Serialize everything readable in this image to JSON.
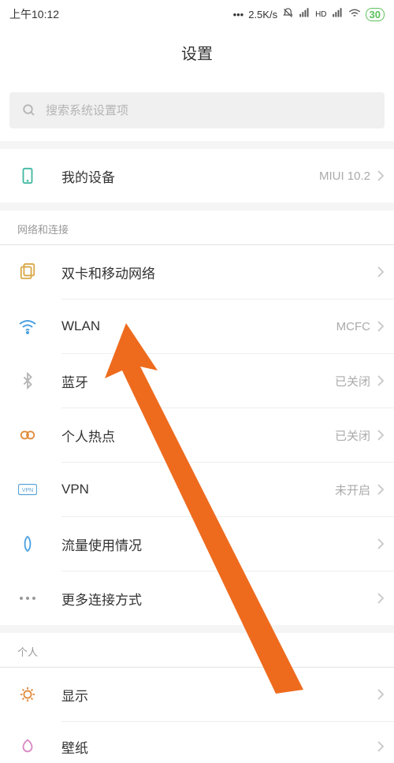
{
  "statusbar": {
    "time": "上午10:12",
    "dots": "•••",
    "speed": "2.5K/s",
    "hd_label": "HD",
    "battery": "30"
  },
  "header": {
    "title": "设置"
  },
  "search": {
    "placeholder": "搜索系统设置项"
  },
  "my_device": {
    "label": "我的设备",
    "value": "MIUI 10.2"
  },
  "sections": {
    "network": {
      "title": "网络和连接",
      "items": [
        {
          "label": "双卡和移动网络",
          "value": ""
        },
        {
          "label": "WLAN",
          "value": "MCFC"
        },
        {
          "label": "蓝牙",
          "value": "已关闭"
        },
        {
          "label": "个人热点",
          "value": "已关闭"
        },
        {
          "label": "VPN",
          "value": "未开启"
        },
        {
          "label": "流量使用情况",
          "value": ""
        },
        {
          "label": "更多连接方式",
          "value": ""
        }
      ]
    },
    "personal": {
      "title": "个人",
      "items": [
        {
          "label": "显示",
          "value": ""
        },
        {
          "label": "壁纸",
          "value": ""
        }
      ]
    }
  }
}
